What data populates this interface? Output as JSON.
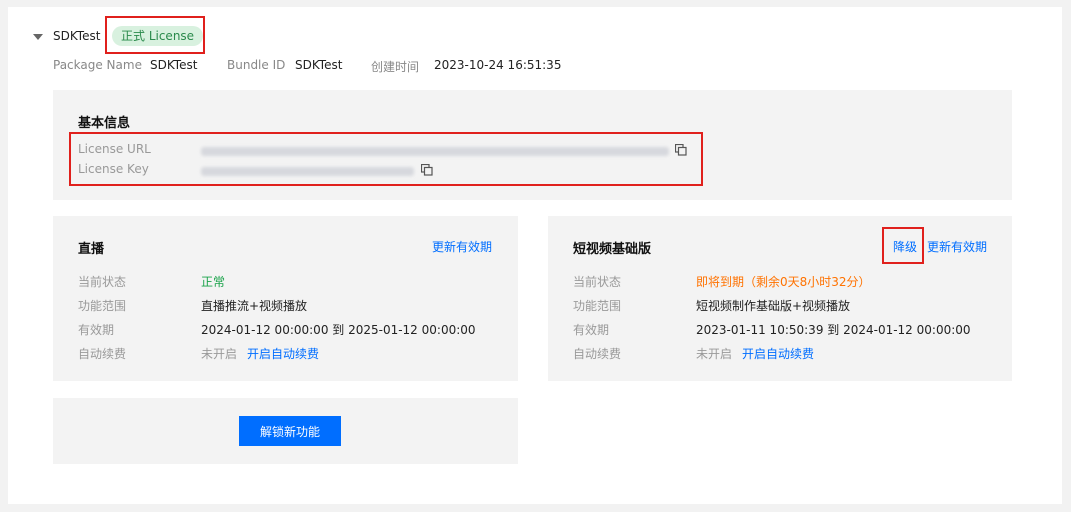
{
  "header": {
    "app_name": "SDKTest",
    "license_badge": "正式 License",
    "package_name_label": "Package Name",
    "package_name_value": "SDKTest",
    "bundle_id_label": "Bundle ID",
    "bundle_id_value": "SDKTest",
    "created_label": "创建时间",
    "created_value": "2023-10-24 16:51:35"
  },
  "basic_info": {
    "title": "基本信息",
    "license_url_label": "License URL",
    "license_key_label": "License Key"
  },
  "live": {
    "title": "直播",
    "renew_link": "更新有效期",
    "status_label": "当前状态",
    "status_value": "正常",
    "scope_label": "功能范围",
    "scope_value": "直播推流+视频播放",
    "validity_label": "有效期",
    "validity_value": "2024-01-12 00:00:00 到 2025-01-12 00:00:00",
    "autorenew_label": "自动续费",
    "autorenew_value": "未开启",
    "autorenew_link": "开启自动续费"
  },
  "shortvideo": {
    "title": "短视频基础版",
    "downgrade_link": "降级",
    "renew_link": "更新有效期",
    "status_label": "当前状态",
    "status_value": "即将到期（剩余0天8小时32分）",
    "scope_label": "功能范围",
    "scope_value": "短视频制作基础版+视频播放",
    "validity_label": "有效期",
    "validity_value": "2023-01-11 10:50:39 到 2024-01-12 00:00:00",
    "autorenew_label": "自动续费",
    "autorenew_value": "未开启",
    "autorenew_link": "开启自动续费"
  },
  "unlock": {
    "button_label": "解锁新功能"
  },
  "colors": {
    "primary": "#006eff",
    "success": "#1aa34a",
    "warning": "#ff7200",
    "highlight": "#e0201c"
  }
}
